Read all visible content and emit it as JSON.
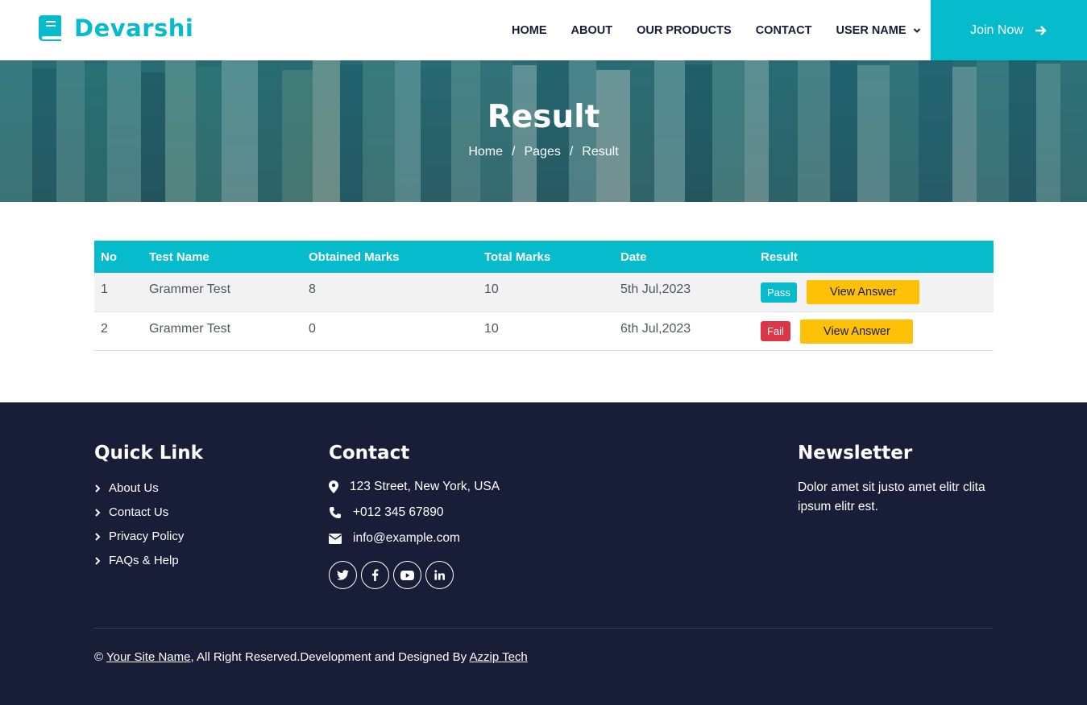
{
  "brand": {
    "name": "Devarshi",
    "color": "#06bbcc",
    "icon": "book-icon"
  },
  "nav": {
    "items": [
      "HOME",
      "ABOUT",
      "OUR PRODUCTS",
      "CONTACT",
      "USER NAME"
    ],
    "join_label": "Join Now"
  },
  "hero": {
    "title": "Result",
    "breadcrumb": [
      "Home",
      "Pages",
      "Result"
    ],
    "separator": "/"
  },
  "table": {
    "headers": [
      "No",
      "Test Name",
      "Obtained Marks",
      "Total Marks",
      "Date",
      "Result"
    ],
    "rows": [
      {
        "no": "1",
        "test": "Grammer Test",
        "obtained": "8",
        "total": "10",
        "date": "5th Jul,2023",
        "result": "Pass",
        "action": "View Answer"
      },
      {
        "no": "2",
        "test": "Grammer Test",
        "obtained": "0",
        "total": "10",
        "date": "6th Jul,2023",
        "result": "Fail",
        "action": "View Answer"
      }
    ]
  },
  "footer": {
    "quick_link": {
      "title": "Quick Link",
      "items": [
        "About Us",
        "Contact Us",
        "Privacy Policy",
        "FAQs & Help"
      ]
    },
    "contact": {
      "title": "Contact",
      "address": "123 Street, New York, USA",
      "phone": "+012 345 67890",
      "email": "info@example.com",
      "social": [
        "twitter-icon",
        "facebook-icon",
        "youtube-icon",
        "linkedin-icon"
      ]
    },
    "newsletter": {
      "title": "Newsletter",
      "text": "Dolor amet sit justo amet elitr clita ipsum elitr est."
    },
    "copyright": {
      "symbol": "©",
      "site_name": "Your Site Name",
      "middle": ", All Right Reserved.Development and Designed By",
      "designer": "Azzip Tech"
    }
  },
  "colors": {
    "primary": "#06bbcc",
    "dark": "#181d38",
    "warning": "#ffc107",
    "danger": "#dc3545"
  }
}
